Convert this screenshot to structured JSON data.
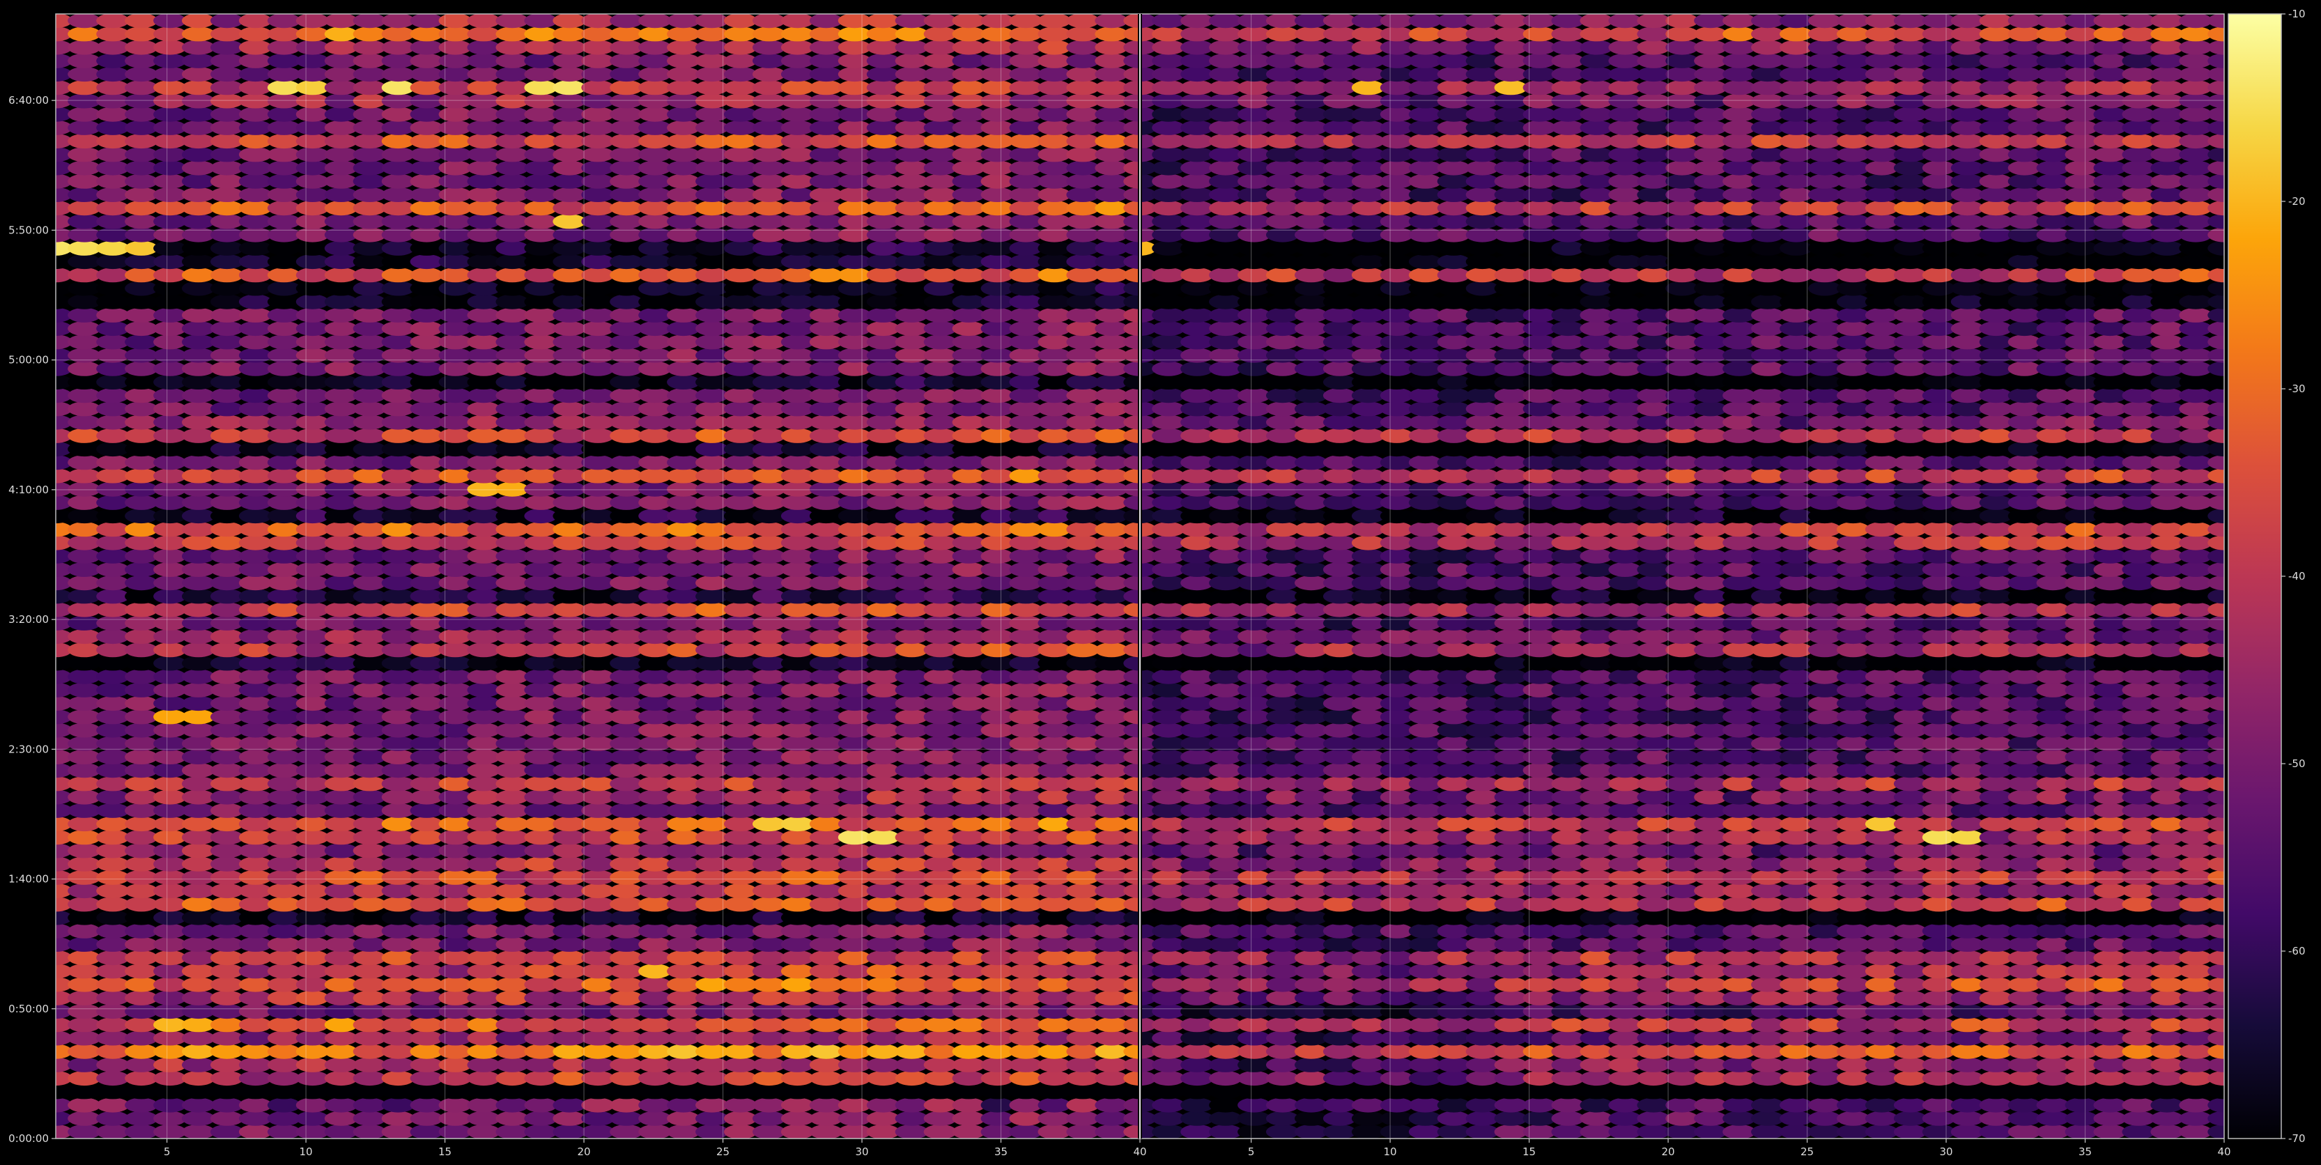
{
  "chart_data": {
    "type": "heatmap",
    "title": "",
    "xlabel": "",
    "ylabel": "",
    "panels": 2,
    "x_range": [
      1,
      40
    ],
    "x_ticks": [
      5,
      10,
      15,
      20,
      25,
      30,
      35,
      40
    ],
    "x_tick_labels": [
      "5",
      "10",
      "15",
      "20",
      "25",
      "30",
      "35",
      "40"
    ],
    "y_range_seconds": [
      0,
      26000
    ],
    "y_ticks_seconds": [
      0,
      3000,
      6000,
      9000,
      12000,
      15000,
      18000,
      21000,
      24000
    ],
    "y_tick_labels": [
      "0:00:00",
      "0:50:00",
      "1:40:00",
      "2:30:00",
      "3:20:00",
      "4:10:00",
      "5:00:00",
      "5:50:00",
      "6:40:00"
    ],
    "rows": 84,
    "columns_per_panel": 39,
    "value_range": [
      -70,
      -10
    ],
    "colormap": "inferno",
    "colorbar_ticks": [
      -10,
      -20,
      -30,
      -40,
      -50,
      -60,
      -70
    ],
    "colorbar_tick_labels": [
      "-10",
      "-20",
      "-30",
      "-40",
      "-50",
      "-60",
      "-70"
    ],
    "grid": true,
    "bright_bands_seconds": [
      800,
      1300,
      1900,
      2100,
      2650,
      3700,
      4100,
      5400,
      5850,
      6200,
      6880,
      7270,
      8100,
      3400,
      11400,
      12300,
      13850,
      14150,
      15300,
      16320,
      19950,
      21500,
      23100,
      24200,
      25680,
      25420
    ],
    "dark_rows_seconds": [
      900,
      1000,
      1200,
      5200,
      11000,
      12600,
      14400,
      15950,
      17500,
      19500,
      20300,
      20700
    ],
    "hotspots": [
      {
        "panel": 0,
        "x": 1,
        "y": 20550,
        "value": -14
      },
      {
        "panel": 0,
        "x": 2,
        "y": 20550,
        "value": -15
      },
      {
        "panel": 0,
        "x": 3,
        "y": 20550,
        "value": -16
      },
      {
        "panel": 0,
        "x": 4,
        "y": 20550,
        "value": -18
      },
      {
        "panel": 1,
        "x": 1,
        "y": 20550,
        "value": -20
      },
      {
        "panel": 0,
        "x": 9,
        "y": 24160,
        "value": -15
      },
      {
        "panel": 0,
        "x": 10,
        "y": 24160,
        "value": -17
      },
      {
        "panel": 0,
        "x": 13,
        "y": 24160,
        "value": -14
      },
      {
        "panel": 0,
        "x": 18,
        "y": 24160,
        "value": -15
      },
      {
        "panel": 0,
        "x": 19,
        "y": 24160,
        "value": -14
      },
      {
        "panel": 1,
        "x": 9,
        "y": 24160,
        "value": -20
      },
      {
        "panel": 1,
        "x": 14,
        "y": 24160,
        "value": -19
      },
      {
        "panel": 0,
        "x": 30,
        "y": 7000,
        "value": -14
      },
      {
        "panel": 0,
        "x": 31,
        "y": 7000,
        "value": -15
      },
      {
        "panel": 0,
        "x": 27,
        "y": 7150,
        "value": -18
      },
      {
        "panel": 0,
        "x": 28,
        "y": 7150,
        "value": -17
      },
      {
        "panel": 1,
        "x": 30,
        "y": 7000,
        "value": -15
      },
      {
        "panel": 1,
        "x": 28,
        "y": 7150,
        "value": -18
      },
      {
        "panel": 1,
        "x": 31,
        "y": 7000,
        "value": -16
      },
      {
        "panel": 0,
        "x": 19,
        "y": 21050,
        "value": -18
      },
      {
        "panel": 0,
        "x": 5,
        "y": 2550,
        "value": -20
      },
      {
        "panel": 0,
        "x": 6,
        "y": 2550,
        "value": -21
      },
      {
        "panel": 0,
        "x": 11,
        "y": 2550,
        "value": -22
      },
      {
        "panel": 0,
        "x": 5,
        "y": 9900,
        "value": -22
      },
      {
        "panel": 0,
        "x": 6,
        "y": 9900,
        "value": -22
      },
      {
        "panel": 0,
        "x": 23,
        "y": 3950,
        "value": -20
      },
      {
        "panel": 0,
        "x": 16,
        "y": 14900,
        "value": -20
      },
      {
        "panel": 0,
        "x": 17,
        "y": 14900,
        "value": -21
      }
    ]
  }
}
